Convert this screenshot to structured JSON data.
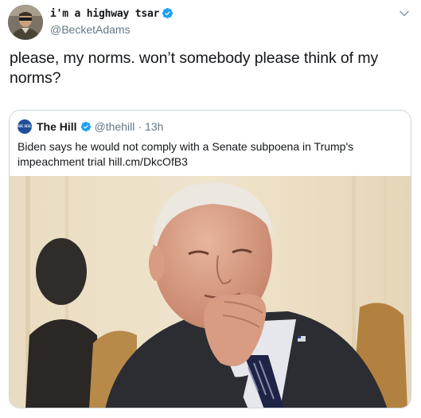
{
  "tweet": {
    "author": {
      "display_name": "i'm a highway tsar",
      "handle": "@BecketAdams",
      "verified": true
    },
    "text": "please, my norms. won’t somebody please think of my norms?",
    "quoted_tweet": {
      "author_name": "The Hill",
      "author_avatar_text": "THE HILL",
      "handle": "@thehill",
      "separator": "·",
      "time": "13h",
      "verified": true,
      "text": "Biden says he would not comply with a Senate subpoena in Trump's impeachment trial hill.cm/DkcOfB3"
    }
  },
  "colors": {
    "verified_blue": "#1da1f2",
    "secondary_text": "#657786",
    "border": "#ccd6dd"
  }
}
